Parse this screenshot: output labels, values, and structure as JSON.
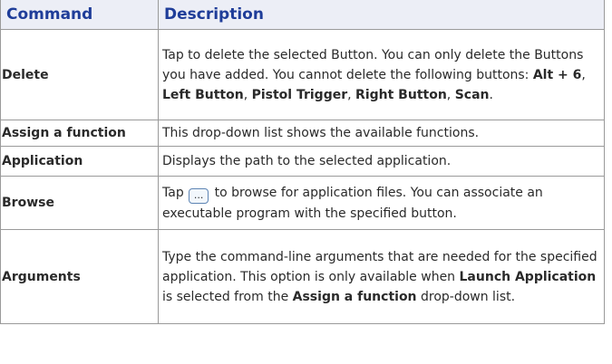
{
  "table": {
    "headers": [
      "Command",
      "Description"
    ],
    "rows": [
      {
        "command": "Delete",
        "desc": {
          "t1": "Tap to delete the selected Button. You can only delete the Buttons you have added. You cannot delete the following buttons: ",
          "b1": "Alt + 6",
          "t2": ", ",
          "b2": "Left Button",
          "t3": ", ",
          "b3": "Pistol Trigger",
          "t4": ", ",
          "b4": "Right Button",
          "t5": ", ",
          "b5": "Scan",
          "t6": "."
        }
      },
      {
        "command": "Assign a function",
        "desc": {
          "t1": "This drop-down list shows the available functions."
        }
      },
      {
        "command": "Application",
        "desc": {
          "t1": "Displays the path to the selected application."
        }
      },
      {
        "command": "Browse",
        "desc": {
          "t1": "Tap ",
          "button": "...",
          "t2": " to browse for application files. You can associate an executable program with the specified button."
        }
      },
      {
        "command": "Arguments",
        "desc": {
          "t1": "Type the command-line arguments that are needed for the specified application. This option is only available when ",
          "b1": "Launch Application",
          "t2": " is selected from the ",
          "b2": "Assign a function",
          "t3": " drop-down list."
        }
      }
    ]
  },
  "colors": {
    "header_text": "#1f3d99",
    "header_bg": "#eceef6",
    "border": "#9a9a9a",
    "body_text": "#2a2a2a"
  }
}
